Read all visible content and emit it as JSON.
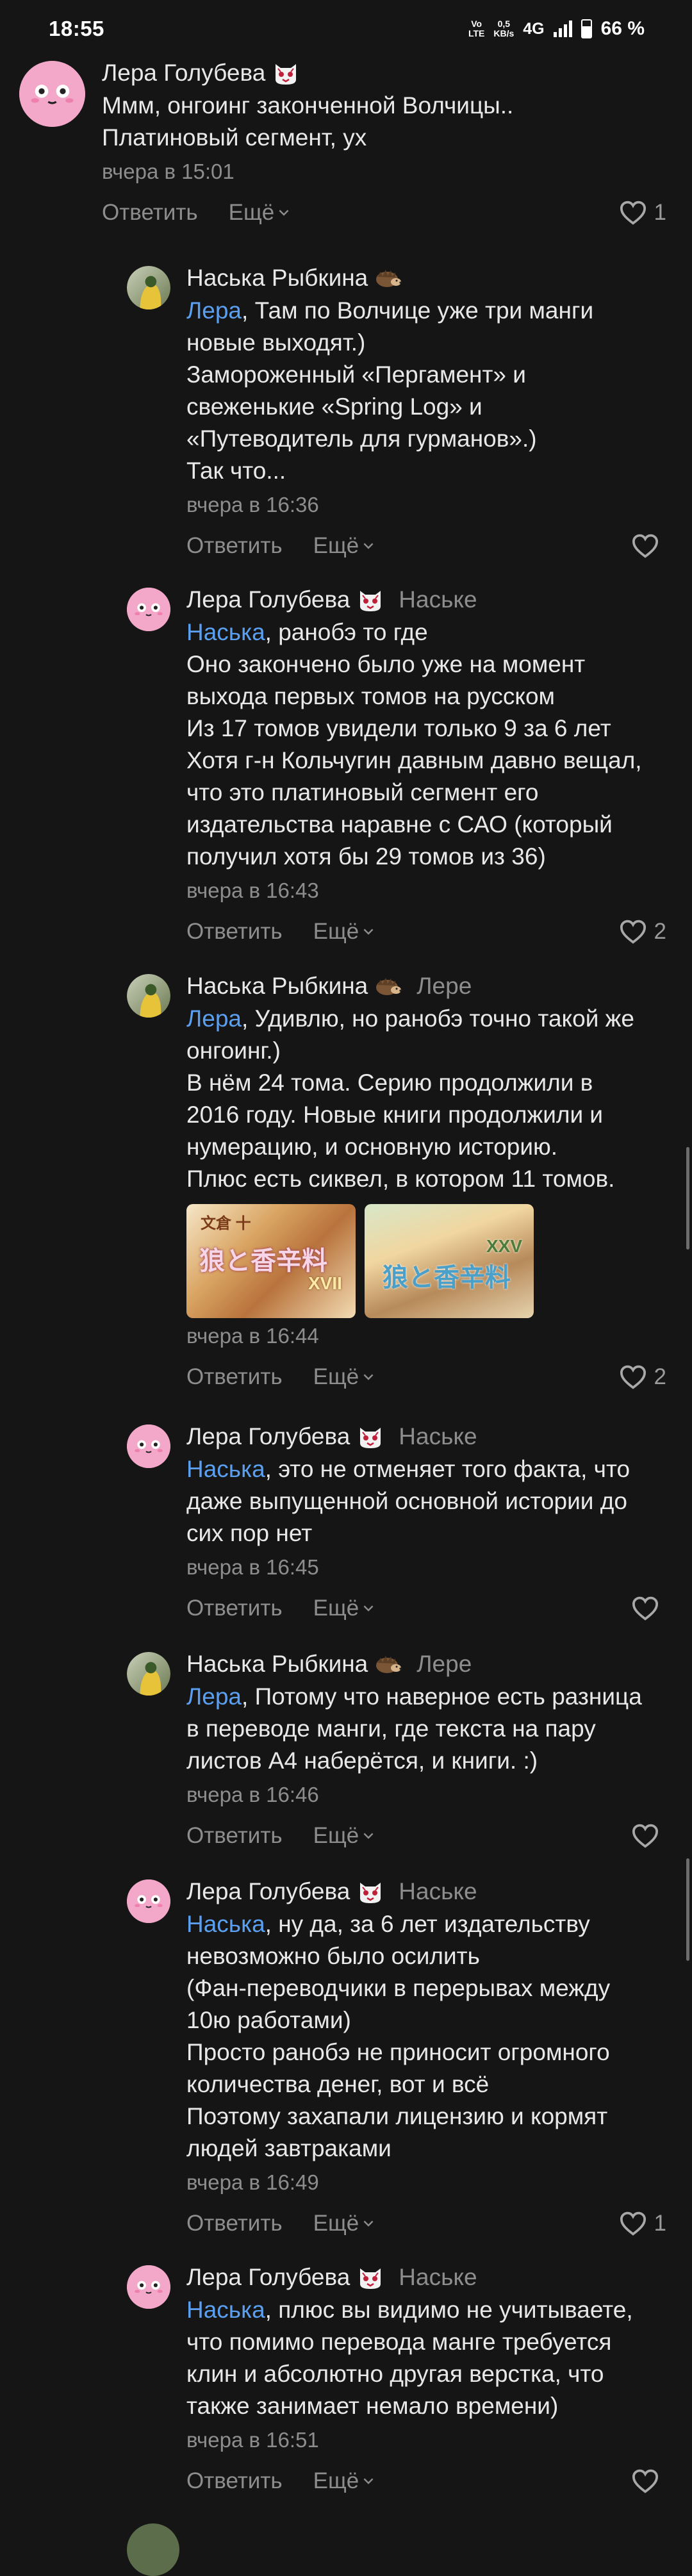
{
  "status_bar": {
    "time": "18:55",
    "volte_top": "Vo",
    "volte_bottom": "LTE",
    "speed_top": "0,5",
    "speed_bottom": "KB/s",
    "network": "4G",
    "battery": "66 %"
  },
  "actions": {
    "reply_label": "Ответить",
    "more_label": "Ещё"
  },
  "comments": [
    {
      "author": "Лера Голубева",
      "text": "Ммм, онгоинг законченной Волчицы..\nПлатиновый сегмент, ух",
      "time": "вчера в 15:01",
      "likes": "1"
    },
    {
      "author": "Наська Рыбкина",
      "mention": "Лера",
      "text": ", Там по Волчице уже три манги\nновые выходят.)\nЗамороженный «Пергамент» и\nсвеженькие «Spring Log» и\n«Путеводитель для гурманов».)\nТак что...",
      "time": "вчера в 16:36",
      "likes": ""
    },
    {
      "author": "Лера Голубева",
      "reply_to": "Наське",
      "mention": "Наська",
      "text": ", ранобэ то где\nОно закончено было уже на момент\nвыхода первых томов на русском\nИз 17 томов увидели только 9 за 6 лет\nХотя г-н Кольчугин давным давно вещал,\nчто это платиновый сегмент его\nиздательства наравне с САО (который\nполучил хотя бы 29 томов из 36)",
      "time": "вчера в 16:43",
      "likes": "2"
    },
    {
      "author": "Наська Рыбкина",
      "reply_to": "Лере",
      "mention": "Лера",
      "text": ", Удивлю, но ранобэ точно такой же\nонгоинг.)\nВ нём 24 тома. Серию продолжили в\n2016 году. Новые книги продолжили и\nнумерацию, и основную историю.\nПлюс есть сиквел, в котором 11 томов.",
      "time": "вчера в 16:44",
      "likes": "2",
      "images": [
        {
          "title": "狼と香辛料",
          "badge": "XVII",
          "top_text": "文倉 十"
        },
        {
          "title": "狼と香辛料",
          "badge": "XXV"
        }
      ]
    },
    {
      "author": "Лера Голубева",
      "reply_to": "Наське",
      "mention": "Наська",
      "text": ", это не отменяет того факта, что\nдаже выпущенной основной истории до\nсих пор нет",
      "time": "вчера в 16:45",
      "likes": ""
    },
    {
      "author": "Наська Рыбкина",
      "reply_to": "Лере",
      "mention": "Лера",
      "text": ", Потому что наверное есть разница\nв переводе манги, где текста на пару\nлистов А4 наберётся, и книги. :)",
      "time": "вчера в 16:46",
      "likes": ""
    },
    {
      "author": "Лера Голубева",
      "reply_to": "Наське",
      "mention": "Наська",
      "text": ", ну да, за 6 лет издательству\nневозможно было осилить\n(Фан-переводчики в перерывах между\n10ю работами)\nПросто ранобэ не приносит огромного\nколичества денег, вот и всё\nПоэтому захапали лицензию и кормят\nлюдей завтраками",
      "time": "вчера в 16:49",
      "likes": "1"
    },
    {
      "author": "Лера Голубева",
      "reply_to": "Наське",
      "mention": "Наська",
      "text": ", плюс вы видимо не учитываете,\nчто помимо перевода манге требуется\nклин и абсолютно другая верстка, что\nтакже занимает немало времени)",
      "time": "вчера в 16:51",
      "likes": ""
    }
  ],
  "colors": {
    "background": "#151515",
    "mention": "#5a9ff0",
    "secondary": "#8d8d8d",
    "avatar_pink": "#f3a7c9"
  }
}
